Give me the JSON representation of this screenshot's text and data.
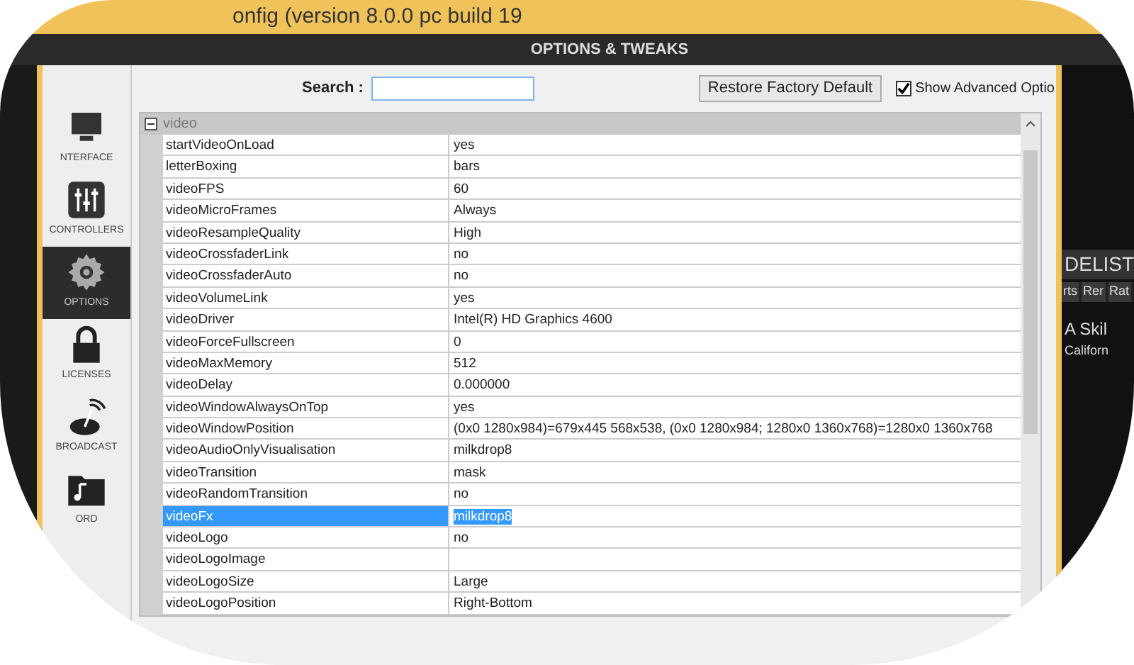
{
  "window": {
    "title": "onfig (version 8.0.0 pc build 19"
  },
  "header": {
    "title": "OPTIONS & TWEAKS"
  },
  "sidebar": {
    "items": [
      {
        "label": "NTERFACE",
        "kind": "monitor",
        "selected": false
      },
      {
        "label": "CONTROLLERS",
        "kind": "sliders",
        "selected": false
      },
      {
        "label": "OPTIONS",
        "kind": "gear",
        "selected": true
      },
      {
        "label": "LICENSES",
        "kind": "lock",
        "selected": false
      },
      {
        "label": "BROADCAST",
        "kind": "antenna",
        "selected": false
      },
      {
        "label": "ORD",
        "kind": "folder",
        "selected": false
      }
    ]
  },
  "toolbar": {
    "search_label": "Search :",
    "restore_button": "Restore Factory Default",
    "advanced": {
      "label": "Show Advanced Optio",
      "checked": true
    }
  },
  "group": {
    "name": "video",
    "expanded": true,
    "rows": [
      {
        "name": "startVideoOnLoad",
        "value": "yes",
        "selected": false
      },
      {
        "name": "letterBoxing",
        "value": "bars",
        "selected": false
      },
      {
        "name": "videoFPS",
        "value": "60",
        "selected": false
      },
      {
        "name": "videoMicroFrames",
        "value": "Always",
        "selected": false
      },
      {
        "name": "videoResampleQuality",
        "value": "High",
        "selected": false
      },
      {
        "name": "videoCrossfaderLink",
        "value": "no",
        "selected": false
      },
      {
        "name": "videoCrossfaderAuto",
        "value": "no",
        "selected": false
      },
      {
        "name": "videoVolumeLink",
        "value": "yes",
        "selected": false
      },
      {
        "name": "videoDriver",
        "value": "Intel(R) HD Graphics 4600",
        "selected": false
      },
      {
        "name": "videoForceFullscreen",
        "value": "0",
        "selected": false
      },
      {
        "name": "videoMaxMemory",
        "value": "512",
        "selected": false
      },
      {
        "name": "videoDelay",
        "value": "0.000000",
        "selected": false
      },
      {
        "name": "videoWindowAlwaysOnTop",
        "value": "yes",
        "selected": false
      },
      {
        "name": "videoWindowPosition",
        "value": "(0x0 1280x984)=679x445 568x538, (0x0 1280x984; 1280x0 1360x768)=1280x0 1360x768",
        "selected": false
      },
      {
        "name": "videoAudioOnlyVisualisation",
        "value": "milkdrop8",
        "selected": false
      },
      {
        "name": "videoTransition",
        "value": "mask",
        "selected": false
      },
      {
        "name": "videoRandomTransition",
        "value": "no",
        "selected": false
      },
      {
        "name": "videoFx",
        "value": "milkdrop8",
        "selected": true
      },
      {
        "name": "videoLogo",
        "value": "no",
        "selected": false
      },
      {
        "name": "videoLogoImage",
        "selected": false
      },
      {
        "name": "videoLogoSize",
        "value": "Large",
        "selected": false
      },
      {
        "name": "videoLogoPosition",
        "value": "Right-Bottom",
        "selected": false
      }
    ]
  },
  "right_panel": {
    "title": "DELIST",
    "columns": [
      "rts",
      "Rer",
      "Rat"
    ],
    "track": "A Skil",
    "artist": "Californ"
  }
}
